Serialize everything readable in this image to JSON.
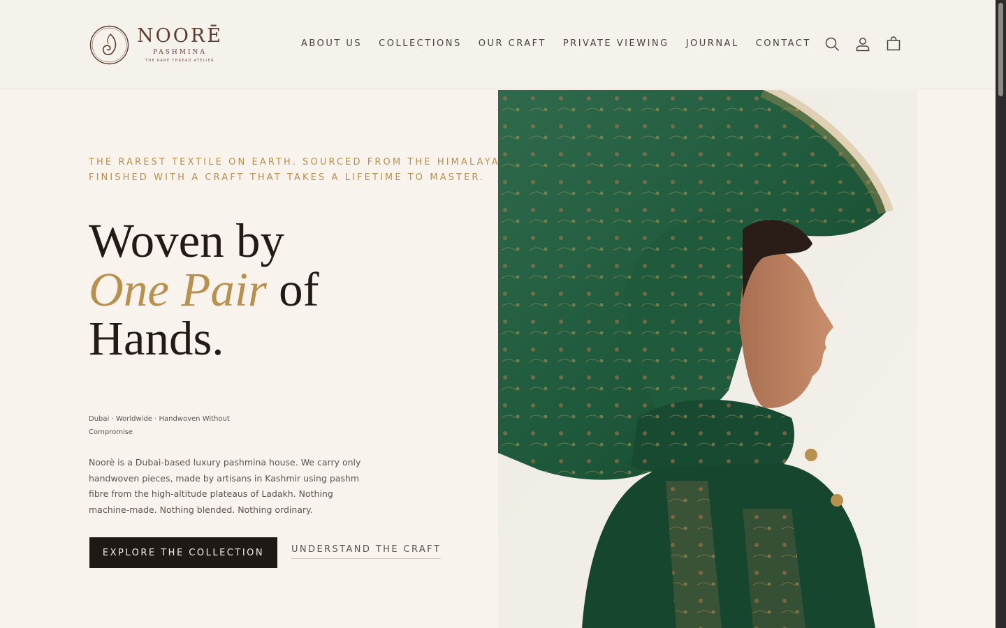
{
  "brand": {
    "name": "NOORĒ",
    "sub": "PASHMINA",
    "tagline": "THE RARE THREAD ATELIER",
    "accent_color": "#b8914f",
    "dark_color": "#1f1915"
  },
  "nav": {
    "items": [
      {
        "label": "ABOUT US"
      },
      {
        "label": "COLLECTIONS"
      },
      {
        "label": "OUR CRAFT"
      },
      {
        "label": "PRIVATE VIEWING"
      },
      {
        "label": "JOURNAL"
      },
      {
        "label": "CONTACT"
      }
    ]
  },
  "header_icons": [
    "search-icon",
    "account-icon",
    "cart-icon"
  ],
  "hero": {
    "eyebrow_line1": "THE RAREST TEXTILE ON EARTH. SOURCED FROM THE HIMALAYAS.",
    "eyebrow_line2": "FINISHED WITH A CRAFT THAT TAKES A LIFETIME TO MASTER.",
    "headline_line1": "Woven by",
    "headline_accent": "One Pair",
    "headline_line2_rest": " of",
    "headline_line3": "Hands.",
    "meta": "Dubai · Worldwide · Handwoven Without Compromise",
    "body": "Noorè is a Dubai-based luxury pashmina house. We carry only handwoven pieces, made by artisans in Kashmir using pashm fibre from the high-altitude plateaus of Ladakh. Nothing machine-made. Nothing blended. Nothing ordinary.",
    "primary_cta": "EXPLORE THE COLLECTION",
    "secondary_cta": "UNDERSTAND THE CRAFT"
  }
}
